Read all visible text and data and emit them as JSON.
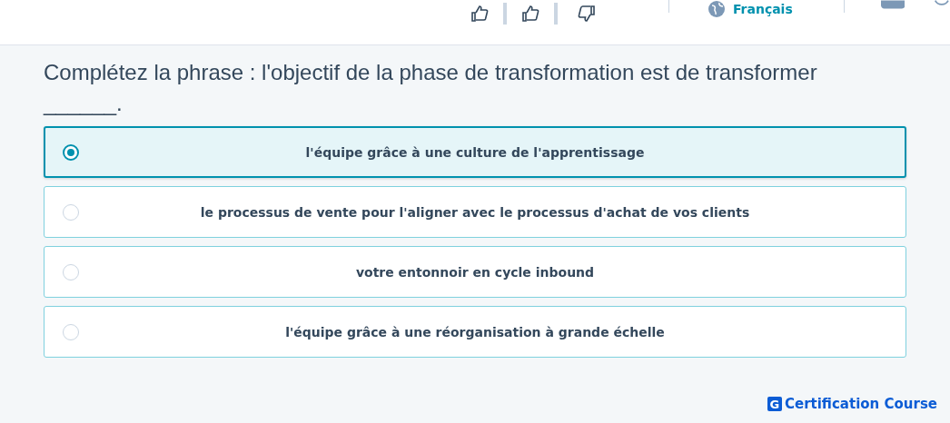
{
  "header": {
    "language": "Français"
  },
  "question": "Complétez la phrase : l'objectif de la phase de transformation est de transformer ______.",
  "options": [
    {
      "label": "l'équipe grâce à une culture de l'apprentissage",
      "selected": true
    },
    {
      "label": "le processus de vente pour l'aligner avec le processus d'achat de vos clients",
      "selected": false
    },
    {
      "label": "votre entonnoir en cycle inbound",
      "selected": false
    },
    {
      "label": "l'équipe grâce à une réorganisation à grande échelle",
      "selected": false
    }
  ],
  "brand": {
    "mark": "G",
    "name": "Certification Course"
  }
}
